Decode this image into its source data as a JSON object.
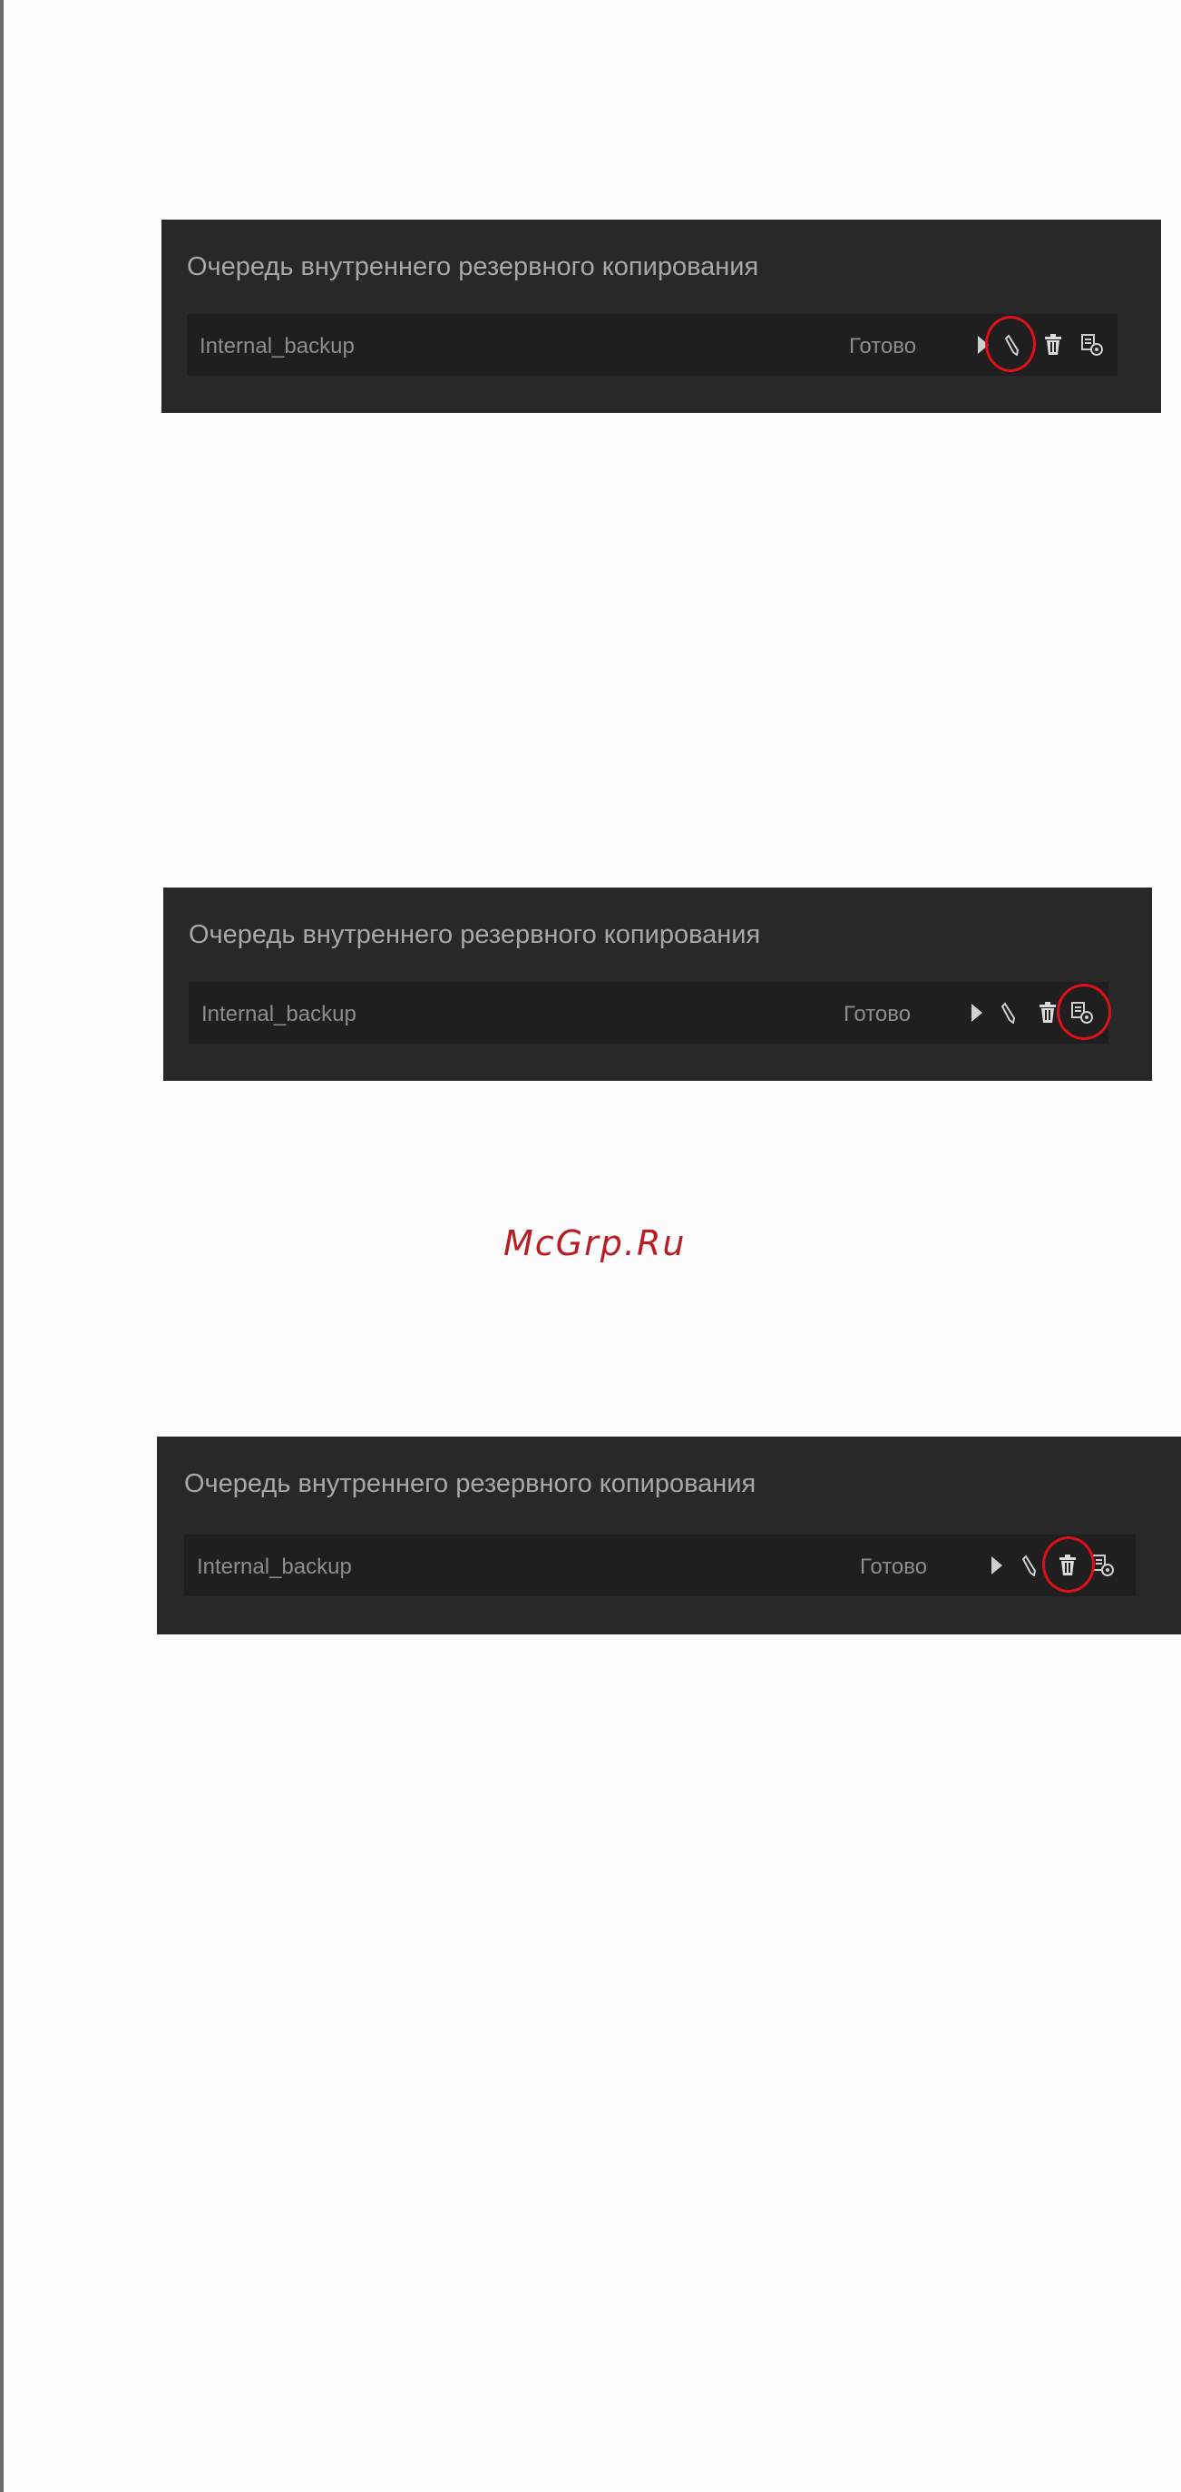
{
  "panels": [
    {
      "title": "Очередь внутреннего резервного копирования",
      "job_name": "Internal_backup",
      "status": "Готово",
      "highlighted_action": "edit"
    },
    {
      "title": "Очередь внутреннего резервного копирования",
      "job_name": "Internal_backup",
      "status": "Готово",
      "highlighted_action": "details"
    },
    {
      "title": "Очередь внутреннего резервного копирования",
      "job_name": "Internal_backup",
      "status": "Готово",
      "highlighted_action": "delete"
    }
  ],
  "watermark": "McGrp.Ru",
  "icons": [
    "play-icon",
    "pencil-icon",
    "trash-icon",
    "details-icon"
  ],
  "colors": {
    "panel_bg": "#282828",
    "row_bg": "#1f1f1f",
    "highlight": "#e0101a",
    "watermark": "#b81d24"
  }
}
